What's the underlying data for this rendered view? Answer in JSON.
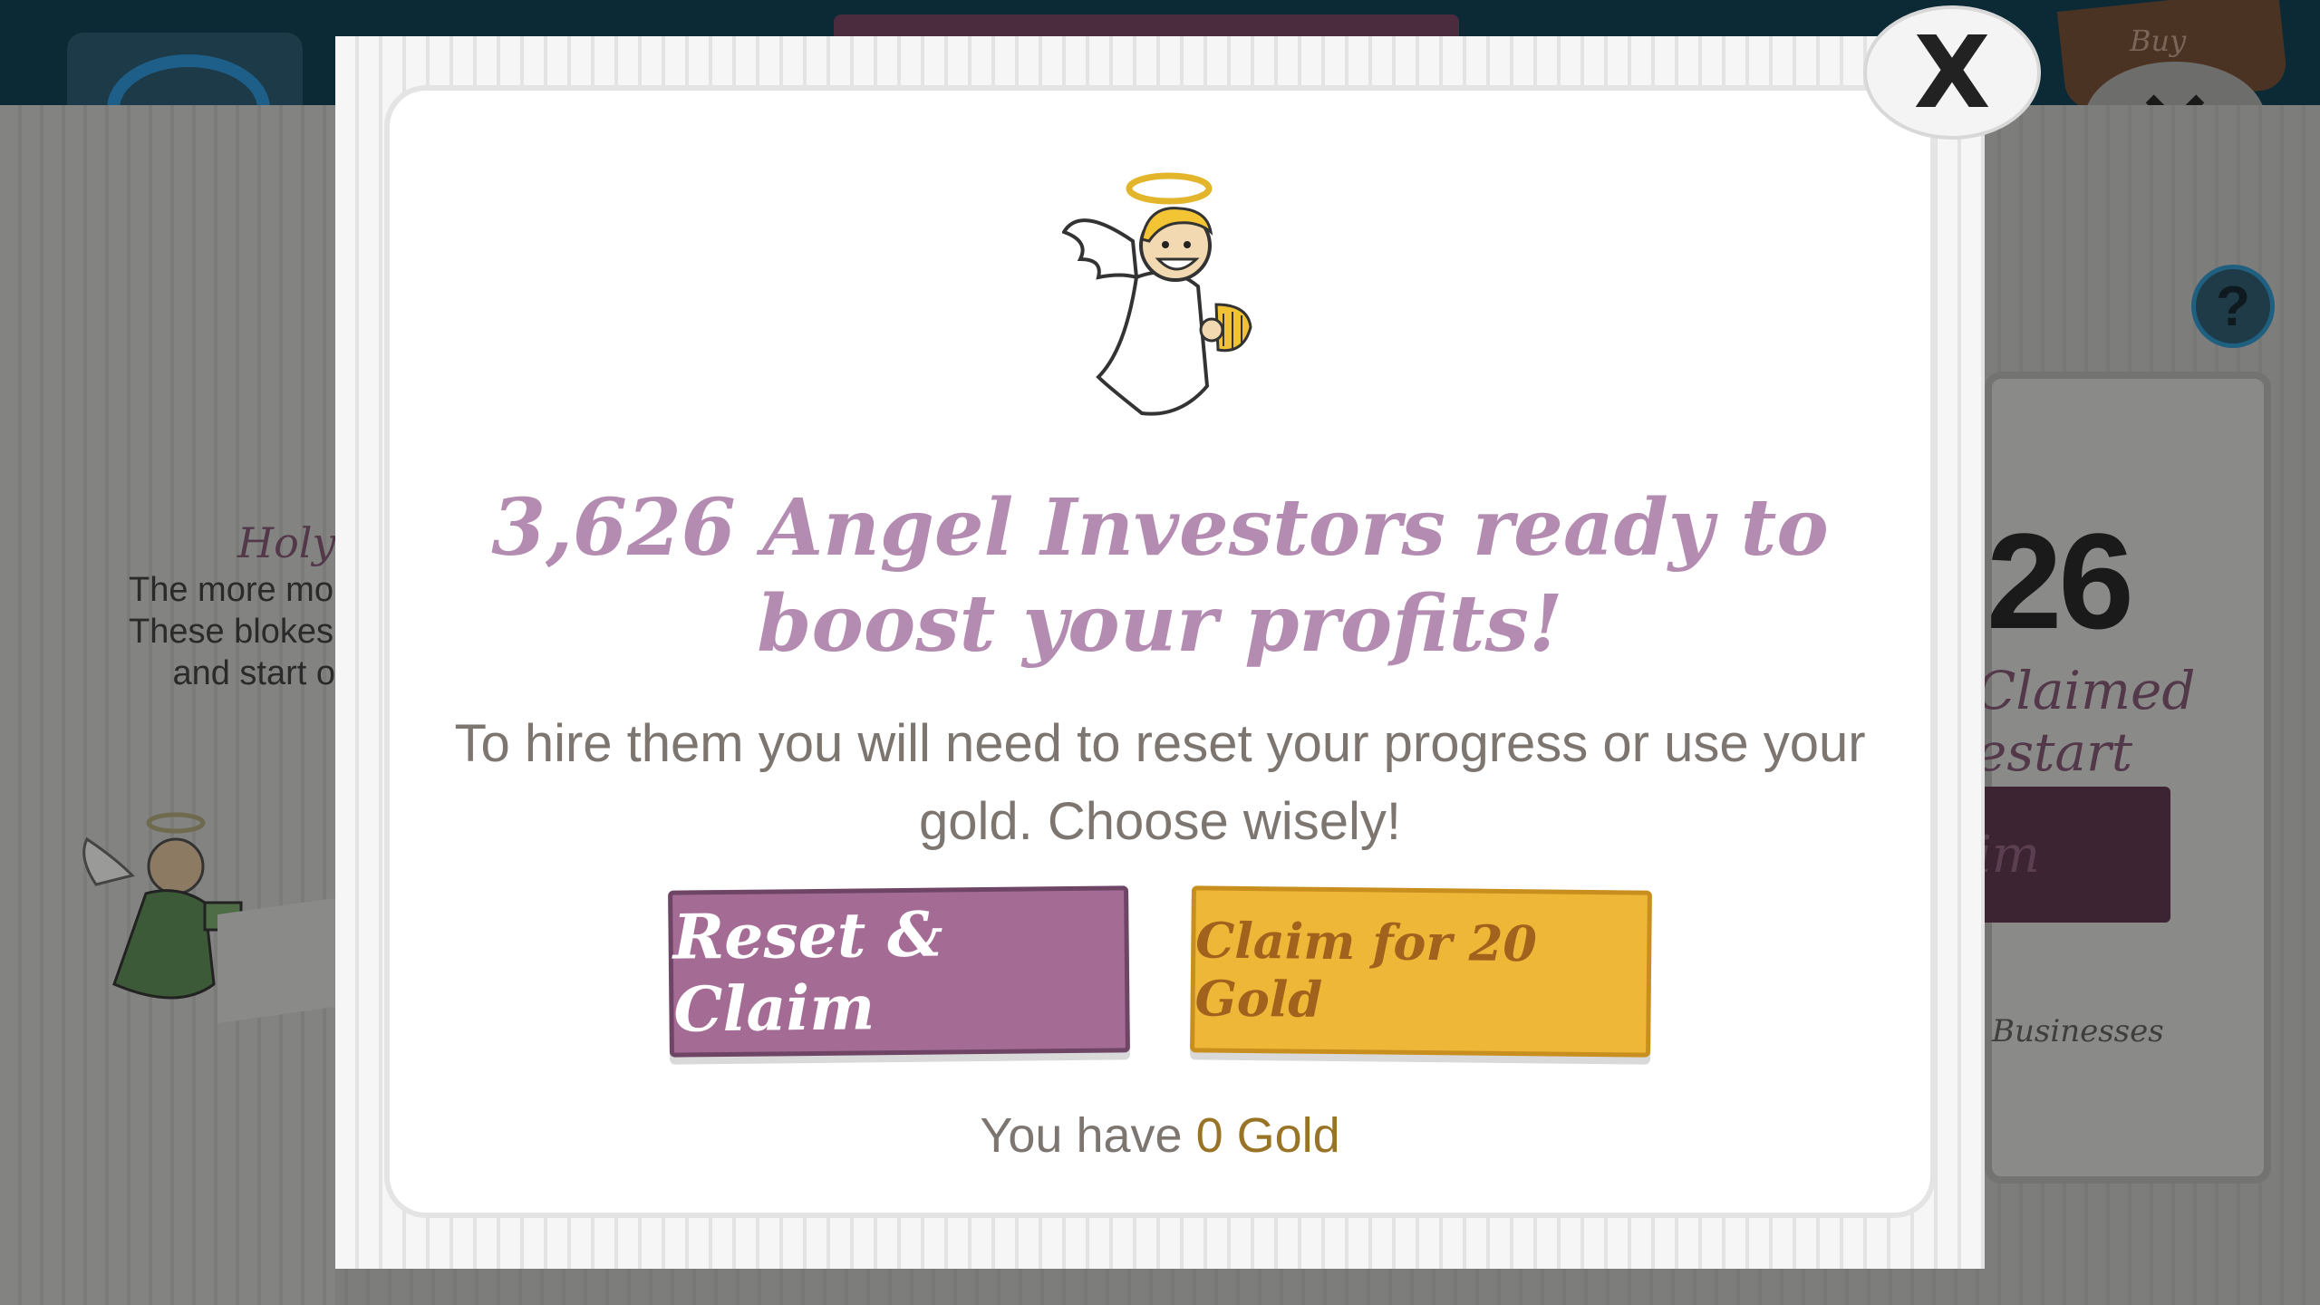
{
  "background": {
    "buy_label": "Buy",
    "left_card": {
      "title": "Holy",
      "description_lines": [
        "The more mon",
        "These blokes inc",
        "and start o"
      ]
    },
    "right_card": {
      "count": "26",
      "claimed_lines": [
        "Claimed",
        "estart"
      ],
      "button_label": "im",
      "businesses_label": "Businesses"
    },
    "help_label": "?"
  },
  "modal": {
    "close_label": "X",
    "headline": "3,626 Angel Investors ready to boost your profits!",
    "subtext": "To hire them you will need to reset your progress or use your gold. Choose wisely!",
    "reset_button_label": "Reset & Claim",
    "gold_button_label": "Claim for 20 Gold",
    "gold_prefix": "You have",
    "gold_amount": "0 Gold"
  },
  "colors": {
    "headline": "#b48bb1",
    "reset_button": "#a46c95",
    "gold_button": "#efb737",
    "gold_text": "#9a7426"
  },
  "icons": [
    "angel-investor-icon",
    "close-icon",
    "help-icon"
  ]
}
